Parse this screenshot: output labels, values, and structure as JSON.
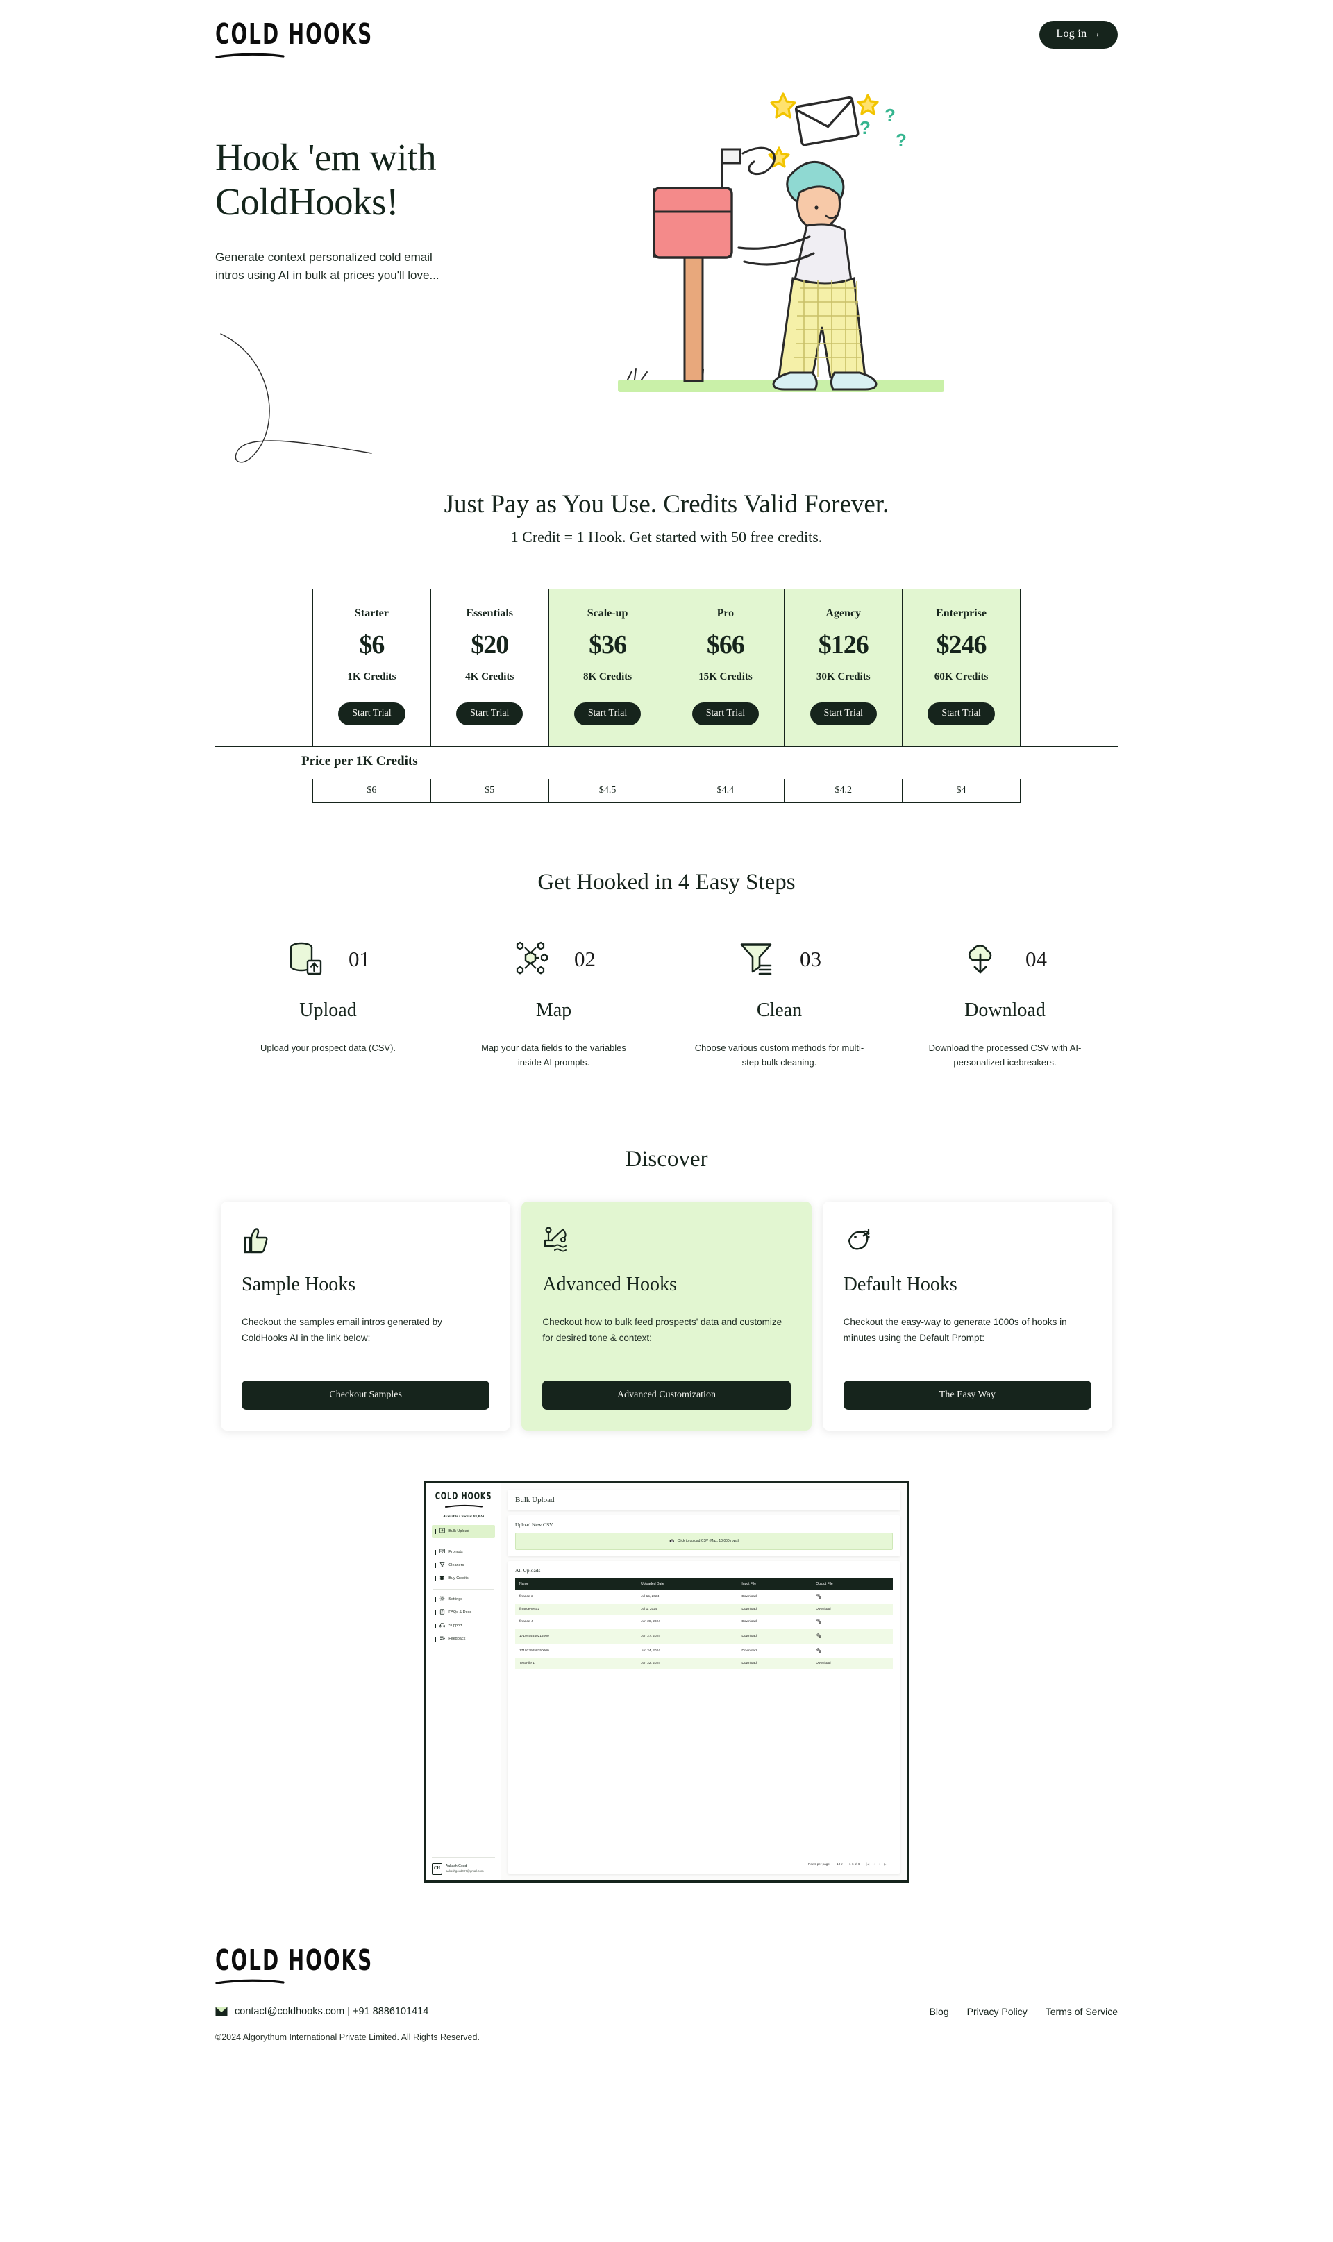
{
  "brand": {
    "name": "COLD HOOKS"
  },
  "header": {
    "login_label": "Log in →"
  },
  "hero": {
    "title_line1": "Hook 'em with",
    "title_line2": "ColdHooks!",
    "subtitle": "Generate context personalized cold email intros using AI in bulk at prices you'll love..."
  },
  "pricing": {
    "title": "Just Pay as You Use. Credits Valid Forever.",
    "subtitle": "1 Credit = 1 Hook. Get started with 50 free credits.",
    "price_per_label": "Price per 1K Credits",
    "cta_label": "Start Trial",
    "highlight_color": "#e2f6d1",
    "plans": [
      {
        "name": "Starter",
        "price": "$6",
        "credits": "1K Credits",
        "per_1k": "$6",
        "highlighted": false
      },
      {
        "name": "Essentials",
        "price": "$20",
        "credits": "4K Credits",
        "per_1k": "$5",
        "highlighted": false
      },
      {
        "name": "Scale-up",
        "price": "$36",
        "credits": "8K Credits",
        "per_1k": "$4.5",
        "highlighted": true
      },
      {
        "name": "Pro",
        "price": "$66",
        "credits": "15K Credits",
        "per_1k": "$4.4",
        "highlighted": true
      },
      {
        "name": "Agency",
        "price": "$126",
        "credits": "30K Credits",
        "per_1k": "$4.2",
        "highlighted": true
      },
      {
        "name": "Enterprise",
        "price": "$246",
        "credits": "60K Credits",
        "per_1k": "$4",
        "highlighted": true
      }
    ]
  },
  "steps": {
    "title": "Get Hooked in 4 Easy Steps",
    "items": [
      {
        "num": "01",
        "name": "Upload",
        "desc": "Upload your prospect data (CSV).",
        "icon": "database-upload-icon"
      },
      {
        "num": "02",
        "name": "Map",
        "desc": "Map your data fields to the variables inside AI prompts.",
        "icon": "node-network-icon"
      },
      {
        "num": "03",
        "name": "Clean",
        "desc": "Choose various custom methods for multi-step bulk cleaning.",
        "icon": "funnel-icon"
      },
      {
        "num": "04",
        "name": "Download",
        "desc": "Download the processed CSV with AI-personalized icebreakers.",
        "icon": "cloud-download-icon"
      }
    ]
  },
  "discover": {
    "title": "Discover",
    "cards": [
      {
        "title": "Sample Hooks",
        "desc": "Checkout the samples email intros generated by ColdHooks AI in the link below:",
        "button": "Checkout Samples",
        "icon": "thumbs-up-icon",
        "highlighted": false
      },
      {
        "title": "Advanced Hooks",
        "desc": "Checkout how to bulk feed prospects' data and customize for desired tone & context:",
        "button": "Advanced Customization",
        "icon": "fishing-rod-icon",
        "highlighted": true
      },
      {
        "title": "Default Hooks",
        "desc": "Checkout the easy-way to generate 1000s of hooks in minutes using the Default Prompt:",
        "button": "The Easy Way",
        "icon": "fish-icon",
        "highlighted": false
      }
    ]
  },
  "app_preview": {
    "sidebar": {
      "logo": "COLD HOOKS",
      "credits_label": "Available Credits: 81,024",
      "items": [
        {
          "label": "Bulk Upload",
          "icon": "upload-box-icon",
          "active": true
        },
        {
          "label": "Prompts",
          "icon": "prompt-card-icon",
          "active": false
        },
        {
          "label": "Cleaners",
          "icon": "funnel-icon",
          "active": false
        },
        {
          "label": "Buy Credits",
          "icon": "coins-icon",
          "active": false
        },
        {
          "label": "Settings",
          "icon": "gear-icon",
          "active": false
        },
        {
          "label": "FAQs & Docs",
          "icon": "document-icon",
          "active": false
        },
        {
          "label": "Support",
          "icon": "headset-icon",
          "active": false
        },
        {
          "label": "Feedback",
          "icon": "feedback-icon",
          "active": false
        }
      ],
      "user": {
        "initials": "CH",
        "name": "Aakash Goud",
        "email": "aakashgoud007@gmail.com"
      }
    },
    "page_title": "Bulk Upload",
    "upload_panel": {
      "title": "Upload New CSV",
      "dropzone_text": "Click to upload CSV (Max. 10,000 rows)"
    },
    "uploads_panel": {
      "title": "All Uploads",
      "columns": [
        "Name",
        "Uploaded Date",
        "Input File",
        "Output File"
      ],
      "rows": [
        {
          "name": "finance-2",
          "date": "Jul 15, 2024",
          "input": "Download",
          "output": "processing"
        },
        {
          "name": "finance-test-2",
          "date": "Jul 1, 2024",
          "input": "Download",
          "output": "Download"
        },
        {
          "name": "finance-4",
          "date": "Jun 28, 2024",
          "input": "Download",
          "output": "processing"
        },
        {
          "name": "1719454649214000",
          "date": "Jun 27, 2024",
          "input": "Download",
          "output": "processing"
        },
        {
          "name": "1719239258350000",
          "date": "Jun 24, 2024",
          "input": "Download",
          "output": "processing"
        },
        {
          "name": "Test File 1",
          "date": "Jun 22, 2024",
          "input": "Download",
          "output": "Download"
        }
      ],
      "rows_per_page_label": "Rows per page:",
      "rows_per_page_value": "10",
      "range_label": "1-6 of 6"
    }
  },
  "footer": {
    "contact": "contact@coldhooks.com | +91 8886101414",
    "links": [
      "Blog",
      "Privacy Policy",
      "Terms of Service"
    ],
    "copyright": "©2024 Algorythum International Private Limited. All Rights Reserved."
  }
}
